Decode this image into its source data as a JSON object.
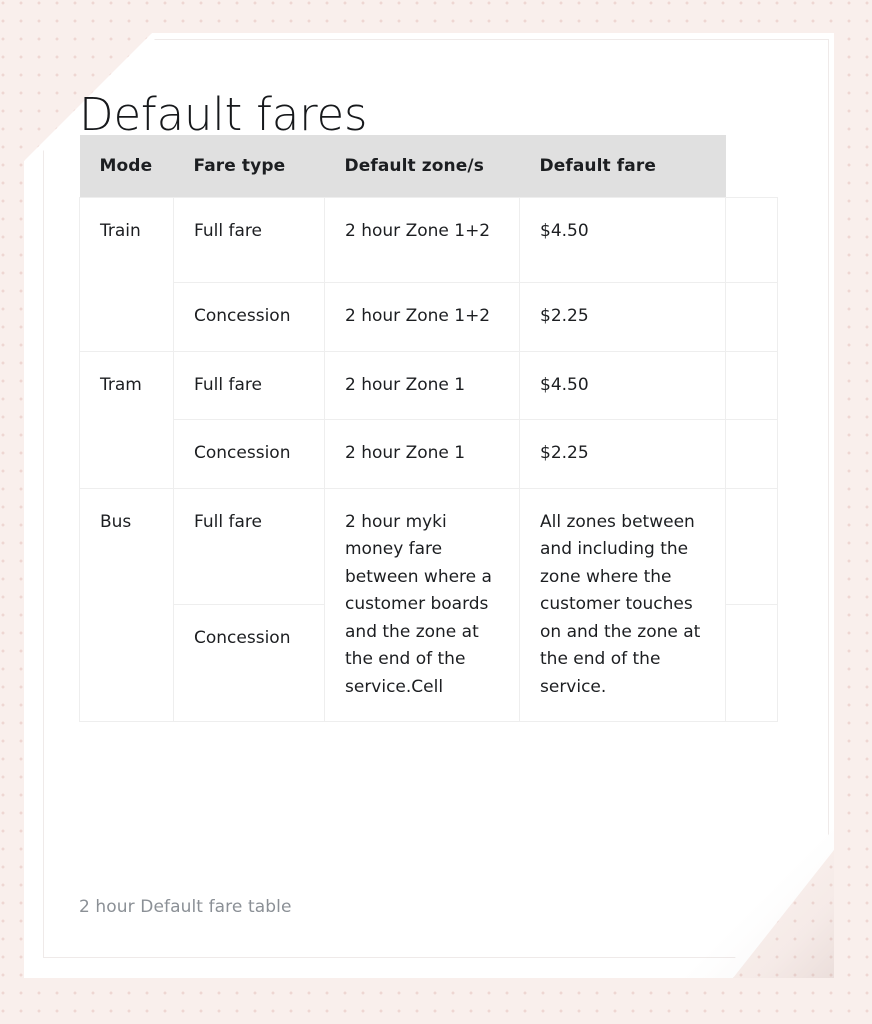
{
  "page": {
    "title": "Default fares",
    "caption": "2 hour Default fare table",
    "background_color": "#f9efec",
    "card_color": "#ffffff",
    "header_fill": "#e0e0e0",
    "text_color": "#1c1e21",
    "caption_color": "#8b9096",
    "grid_line_color": "#eeeeee"
  },
  "table": {
    "headers": {
      "mode": "Mode",
      "fare_type": "Fare type",
      "default_zones": "Default zone/s",
      "default_fare": "Default fare",
      "extra": ""
    },
    "rows": [
      {
        "mode": "Train",
        "fare_type": "Full fare",
        "default_zones": "2 hour Zone 1+2",
        "default_fare": "$4.50"
      },
      {
        "mode": "",
        "fare_type": "Concession",
        "default_zones": "2 hour Zone 1+2",
        "default_fare": "$2.25"
      },
      {
        "mode": "Tram",
        "fare_type": "Full fare",
        "default_zones": "2 hour Zone 1",
        "default_fare": "$4.50"
      },
      {
        "mode": "",
        "fare_type": "Concession",
        "default_zones": "2 hour Zone 1",
        "default_fare": "$2.25"
      },
      {
        "mode": "Bus",
        "fare_type": "Full fare",
        "default_zones": "2 hour myki money fare between where a customer boards and the zone at the end of the service.Cell",
        "default_fare": "All zones between and including the zone where the customer touches on and the zone at the end of the service."
      },
      {
        "mode": "",
        "fare_type": "Concession",
        "default_zones": "",
        "default_fare": ""
      }
    ]
  }
}
